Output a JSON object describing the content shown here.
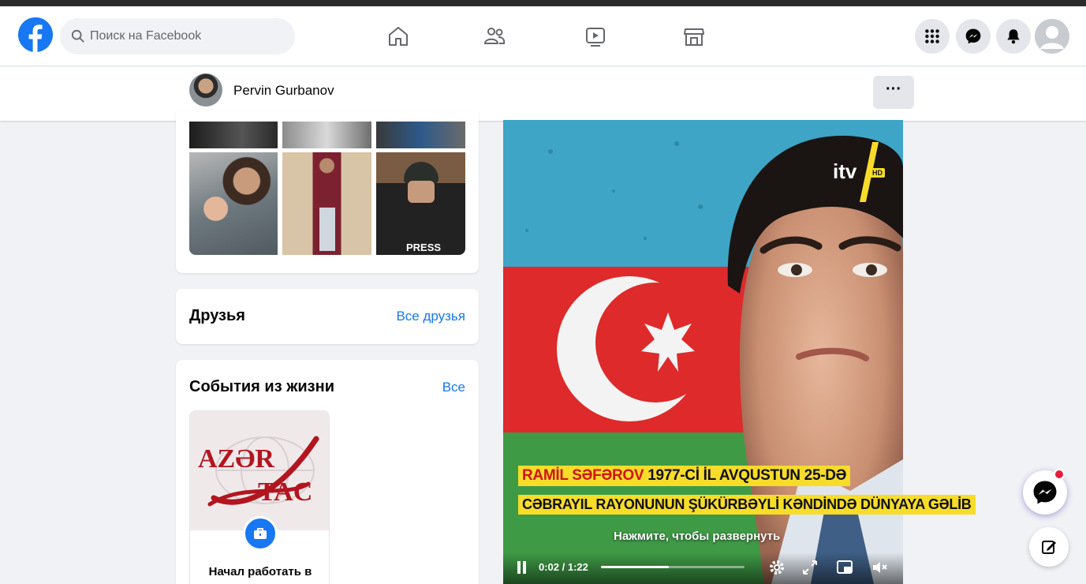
{
  "topbar": {
    "search_placeholder": "Поиск на Facebook",
    "nav_icons": [
      "home-icon",
      "friends-icon",
      "watch-icon",
      "marketplace-icon"
    ],
    "right_icons": [
      "menu-grid-icon",
      "messenger-icon",
      "notifications-icon",
      "account-avatar"
    ]
  },
  "profile": {
    "name": "Pervin Gurbanov",
    "more_label": "···"
  },
  "friends": {
    "title": "Друзья",
    "link": "Все друзья"
  },
  "life_events": {
    "title": "События из жизни",
    "link": "Все",
    "tile_logo_top": "AZƏR",
    "tile_logo_bottom": "TAC",
    "tile_text": "Начал работать в"
  },
  "video": {
    "channel_logo": "itv",
    "channel_hd": "HD",
    "caption_line1_name": "RAMİL SƏFƏROV",
    "caption_line1_rest": " 1977-Cİ İL AVQUSTUN 25-DƏ",
    "caption_line2": "CƏBRAYIL RAYONUNUN ŞÜKÜRBƏYLİ KƏNDİNDƏ DÜNYAYA GƏLİB",
    "expand_hint": "Нажмите, чтобы развернуть",
    "time": "0:02 / 1:22",
    "progress": 0.47
  },
  "colors": {
    "brand": "#1877f2",
    "caption_bg": "#f7dc2a",
    "caption_name": "#d01515",
    "notification_dot": "#e41e3f"
  }
}
